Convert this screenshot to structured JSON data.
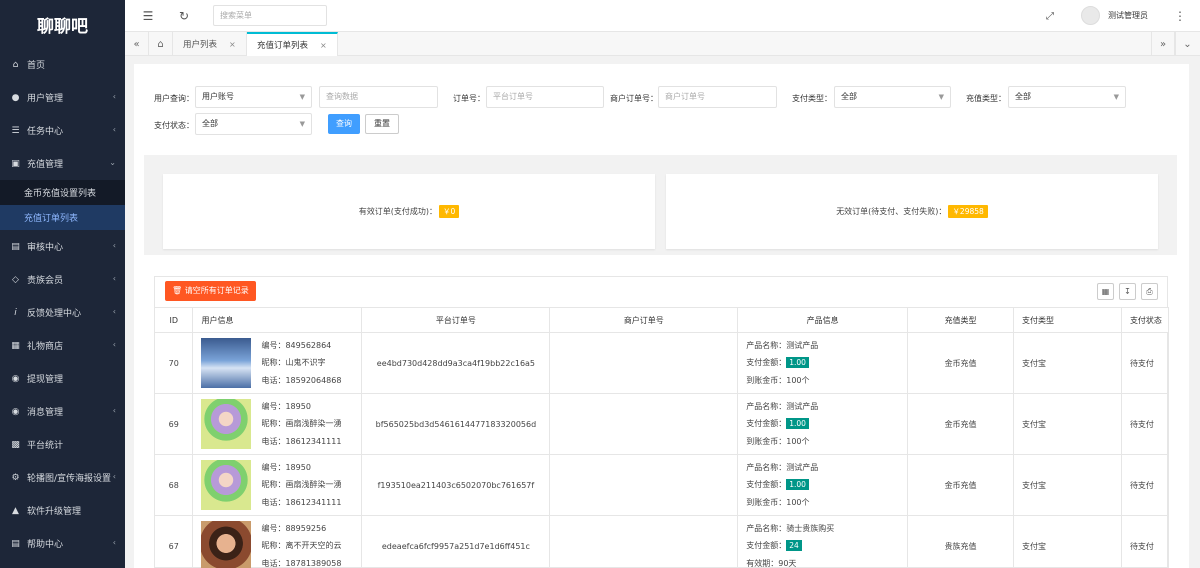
{
  "sidebar": {
    "logo": "聊聊吧",
    "items": [
      {
        "label": "首页"
      },
      {
        "label": "用户管理"
      },
      {
        "label": "任务中心"
      },
      {
        "label": "充值管理"
      },
      {
        "label": "审核中心"
      },
      {
        "label": "贵族会员"
      },
      {
        "label": "反馈处理中心"
      },
      {
        "label": "礼物商店"
      },
      {
        "label": "提现管理"
      },
      {
        "label": "消息管理"
      },
      {
        "label": "平台统计"
      },
      {
        "label": "轮播图/宣传海报设置"
      },
      {
        "label": "软件升级管理"
      },
      {
        "label": "帮助中心"
      }
    ],
    "submenu": [
      {
        "label": "金币充值设置列表"
      },
      {
        "label": "充值订单列表"
      }
    ]
  },
  "topbar": {
    "search_placeholder": "搜索菜单",
    "username": "测试管理员"
  },
  "tabs": [
    {
      "label": "用户列表"
    },
    {
      "label": "充值订单列表"
    }
  ],
  "filters": {
    "user_query_label": "用户查询：",
    "user_query_select": "用户账号",
    "user_query_placeholder": "查询数据",
    "order_no_label": "订单号：",
    "order_no_placeholder": "平台订单号",
    "merchant_no_label": "商户订单号：",
    "merchant_no_placeholder": "商户订单号",
    "pay_type_label": "支付类型：",
    "pay_type_value": "全部",
    "recharge_type_label": "充值类型：",
    "recharge_type_value": "全部",
    "pay_status_label": "支付状态：",
    "pay_status_value": "全部",
    "query_button": "查询",
    "reset_button": "重置"
  },
  "stats": {
    "valid_label": "有效订单(支付成功)：",
    "valid_value": "￥0",
    "invalid_label": "无效订单(待支付、支付失败)：",
    "invalid_value": "￥29858"
  },
  "table": {
    "clear_button": "请空所有订单记录",
    "headers": [
      "ID",
      "用户信息",
      "平台订单号",
      "商户订单号",
      "产品信息",
      "充值类型",
      "支付类型",
      "支付状态"
    ],
    "rows": [
      {
        "id": "70",
        "no": "编号：849562864",
        "nick": "昵称：山鬼不识字",
        "phone": "电话：18592064868",
        "order": "ee4bd730d428dd9a3ca4f19bb22c16a5",
        "merchant": "",
        "p1": "产品名称：测试产品",
        "p2_label": "支付金额：",
        "p2_value": "1.00",
        "p3": "到账金币：100个",
        "recharge": "金币充值",
        "pay": "支付宝",
        "status": "待支付"
      },
      {
        "id": "69",
        "no": "编号：18950",
        "nick": "昵称：画扇浅醉染一湧",
        "phone": "电话：18612341111",
        "order": "bf565025bd3d5461614477183320056d",
        "merchant": "",
        "p1": "产品名称：测试产品",
        "p2_label": "支付金额：",
        "p2_value": "1.00",
        "p3": "到账金币：100个",
        "recharge": "金币充值",
        "pay": "支付宝",
        "status": "待支付"
      },
      {
        "id": "68",
        "no": "编号：18950",
        "nick": "昵称：画扇浅醉染一湧",
        "phone": "电话：18612341111",
        "order": "f193510ea211403c6502070bc761657f",
        "merchant": "",
        "p1": "产品名称：测试产品",
        "p2_label": "支付金额：",
        "p2_value": "1.00",
        "p3": "到账金币：100个",
        "recharge": "金币充值",
        "pay": "支付宝",
        "status": "待支付"
      },
      {
        "id": "67",
        "no": "编号：88959256",
        "nick": "昵称：离不开天空的云",
        "phone": "电话：18781389058",
        "order": "edeaefca6fcf9957a251d7e1d6ff451c",
        "merchant": "",
        "p1": "产品名称：骑士贵族购买",
        "p2_label": "支付金额：",
        "p2_value": "24",
        "p3": "有效期：90天",
        "recharge": "贵族充值",
        "pay": "支付宝",
        "status": "待支付"
      }
    ]
  },
  "colors": {
    "sidebar_bg": "#1d2638",
    "accent_tab": "#00bcd4",
    "query_btn": "#409eff",
    "danger_btn": "#ff5722",
    "badge_yellow": "#ffb800",
    "badge_green": "#009688"
  }
}
